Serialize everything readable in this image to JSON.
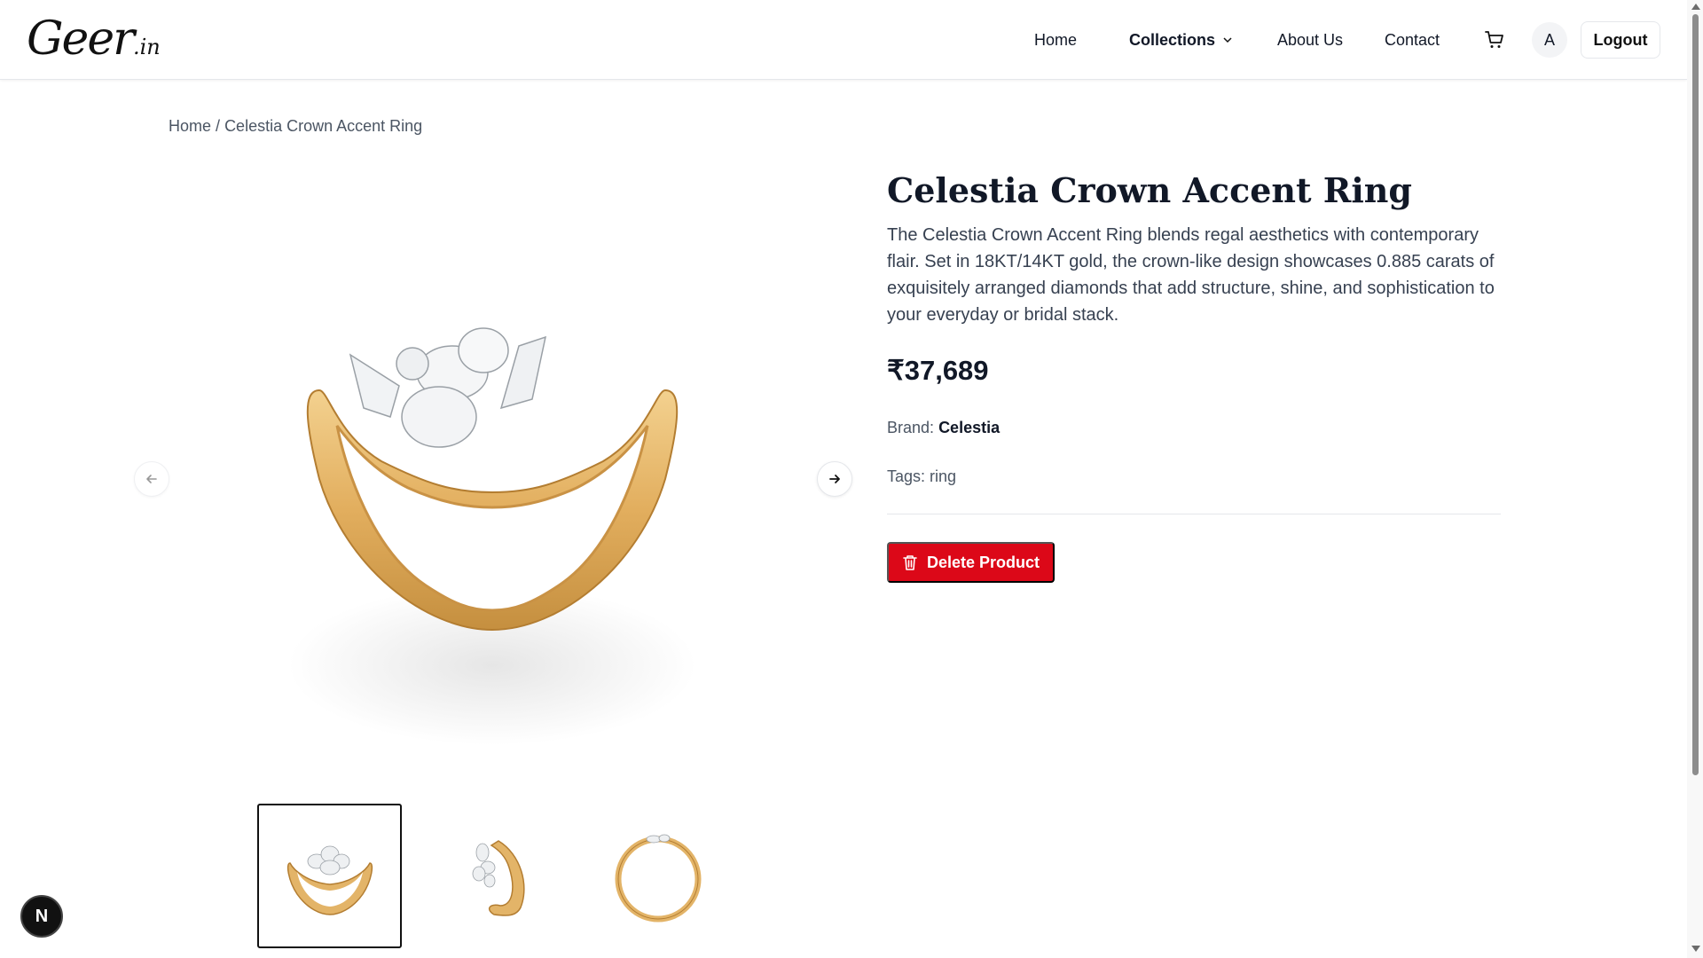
{
  "header": {
    "logo_main": "Geer",
    "logo_suffix": ".in",
    "nav": {
      "home": "Home",
      "collections": "Collections",
      "about": "About Us",
      "contact": "Contact"
    },
    "avatar_initial": "A",
    "logout_label": "Logout"
  },
  "breadcrumb": {
    "home": "Home",
    "separator": "/",
    "current": "Celestia Crown Accent Ring"
  },
  "product": {
    "title": "Celestia Crown Accent Ring",
    "description": "The Celestia Crown Accent Ring blends regal aesthetics with contemporary flair. Set in 18KT/14KT gold, the crown-like design showcases 0.885 carats of exquisitely arranged diamonds that add structure, shine, and sophistication to your everyday or bridal stack.",
    "price": "₹37,689",
    "brand_label": "Brand:",
    "brand_value": "Celestia",
    "tags_label": "Tags:",
    "tags_value": "ring",
    "delete_label": "Delete Product"
  },
  "gallery": {
    "selected_index": 0,
    "thumbnail_count": 3
  },
  "dev_badge": "N",
  "colors": {
    "gold": "#e3b468",
    "gold_dark": "#c58f3f",
    "danger": "#dc0818",
    "text_primary": "#111827",
    "text_muted": "#4b5563"
  }
}
